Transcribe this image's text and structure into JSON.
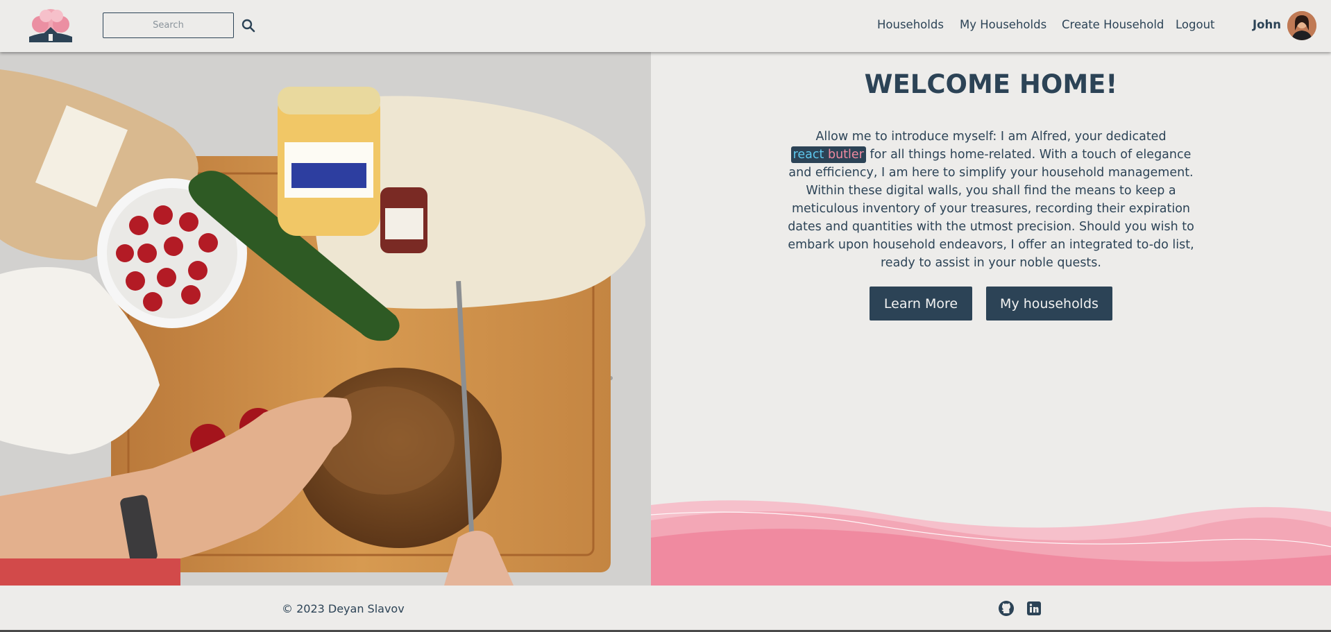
{
  "header": {
    "search": {
      "placeholder": "Search",
      "value": ""
    },
    "nav": [
      {
        "label": "Households"
      },
      {
        "label": "My Households"
      },
      {
        "label": "Create Household"
      },
      {
        "label": "Logout"
      }
    ],
    "user": {
      "name": "John"
    }
  },
  "main": {
    "title": "WELCOME HOME!",
    "intro": {
      "before": "Allow me to introduce myself: I am Alfred, your dedicated",
      "brand_react": "react",
      "brand_butler": "butler",
      "after": "for all things home-related. With a touch of elegance and efficiency, I am here to simplify your household management. Within these digital walls, you shall find the means to keep a meticulous inventory of your treasures, recording their expiration dates and quantities with the utmost precision. Should you wish to embark upon household endeavors, I offer an integrated to-do list, ready to assist in your noble quests."
    },
    "buttons": {
      "learn_more": "Learn More",
      "my_households": "My households"
    }
  },
  "footer": {
    "copyright": "© 2023 Deyan Slavov",
    "social": [
      "github-icon",
      "linkedin-icon"
    ]
  },
  "colors": {
    "primary": "#2c4356",
    "background": "#edecea",
    "wave_pink": "#f08aa0",
    "brand_react": "#5ec8ee",
    "brand_butler": "#f08aa0"
  }
}
